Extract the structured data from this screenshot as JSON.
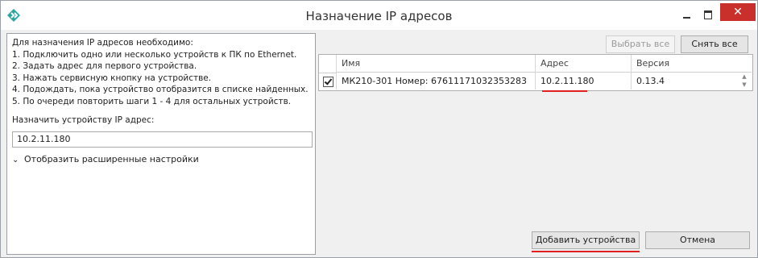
{
  "window": {
    "title": "Назначение IP адресов",
    "close_glyph": "✕",
    "accent_close": "#c9302c",
    "app_icon": "app-logo-icon"
  },
  "instructions": {
    "lines": [
      "Для назначения IP адресов необходимо:",
      "1. Подключить одно или несколько устройств к ПК по Ethernet.",
      "2. Задать адрес для первого устройства.",
      "3. Нажать сервисную кнопку на устройстве.",
      "4. Подождать, пока устройство отобразится в списке найденных.",
      "5. По очереди повторить шаги 1 - 4 для остальных устройств."
    ],
    "ip_label": "Назначить устройству IP адрес:",
    "ip_value": "10.2.11.180",
    "advanced_label": "Отобразить расширенные настройки",
    "advanced_icon": "chevron-down-icon"
  },
  "toolbar": {
    "select_all": "Выбрать все",
    "clear_all": "Снять все"
  },
  "devices": {
    "columns": [
      "Имя",
      "Адрес",
      "Версия"
    ],
    "rows": [
      {
        "checked": true,
        "name": "МК210-301 Номер: 67611171032353283",
        "address": "10.2.11.180",
        "version": "0.13.4"
      }
    ]
  },
  "actions": {
    "add": "Добавить устройства",
    "cancel": "Отмена"
  },
  "highlight_color": "#e02020"
}
